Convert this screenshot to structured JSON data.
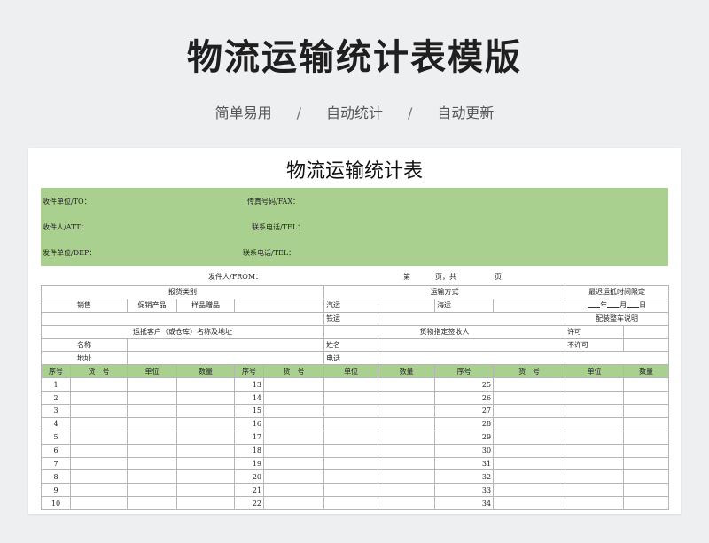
{
  "hero": {
    "title": "物流运输统计表模版",
    "sub": [
      "简单易用",
      "自动统计",
      "自动更新"
    ],
    "sep": "/"
  },
  "sheet": {
    "title": "物流运输统计表",
    "green": {
      "to": "收件单位/TO：",
      "fax": "传真号码/FAX：",
      "att": "收件人/ATT：",
      "tel1": "联系电话/TEL：",
      "dep": "发件单位/DEP：",
      "tel2": "联系电话/TEL："
    },
    "sender": {
      "from": "发件人/FROM：",
      "page_a": "第",
      "page_b": "页，共",
      "page_c": "页"
    },
    "form": {
      "goods_type": "报货类别",
      "transport": "运输方式",
      "deadline": "最迟运抵时间限定",
      "sales": "销售",
      "promo": "促销产品",
      "sample": "样品赠品",
      "truck": "汽运",
      "sea": "海运",
      "rail": "铁运",
      "year": "年",
      "month": "月",
      "day": "日",
      "fullload": "配装整车说明",
      "dest": "运抵客户（或仓库）名称及地址",
      "receiver": "货物指定签收人",
      "allow": "许可",
      "disallow": "不许可",
      "name_lbl": "名称",
      "addr_lbl": "地址",
      "person_name": "姓名",
      "phone": "电话"
    },
    "item_headers": [
      "序号",
      "货　号",
      "单位",
      "数量",
      "序号",
      "货　号",
      "单位",
      "数量",
      "序号",
      "货　号",
      "单位",
      "数量"
    ],
    "rows": [
      [
        "1",
        "13",
        "25"
      ],
      [
        "2",
        "14",
        "26"
      ],
      [
        "3",
        "15",
        "27"
      ],
      [
        "4",
        "16",
        "28"
      ],
      [
        "5",
        "17",
        "29"
      ],
      [
        "6",
        "18",
        "30"
      ],
      [
        "7",
        "19",
        "31"
      ],
      [
        "8",
        "20",
        "32"
      ],
      [
        "9",
        "21",
        "33"
      ],
      [
        "10",
        "22",
        "34"
      ]
    ]
  }
}
